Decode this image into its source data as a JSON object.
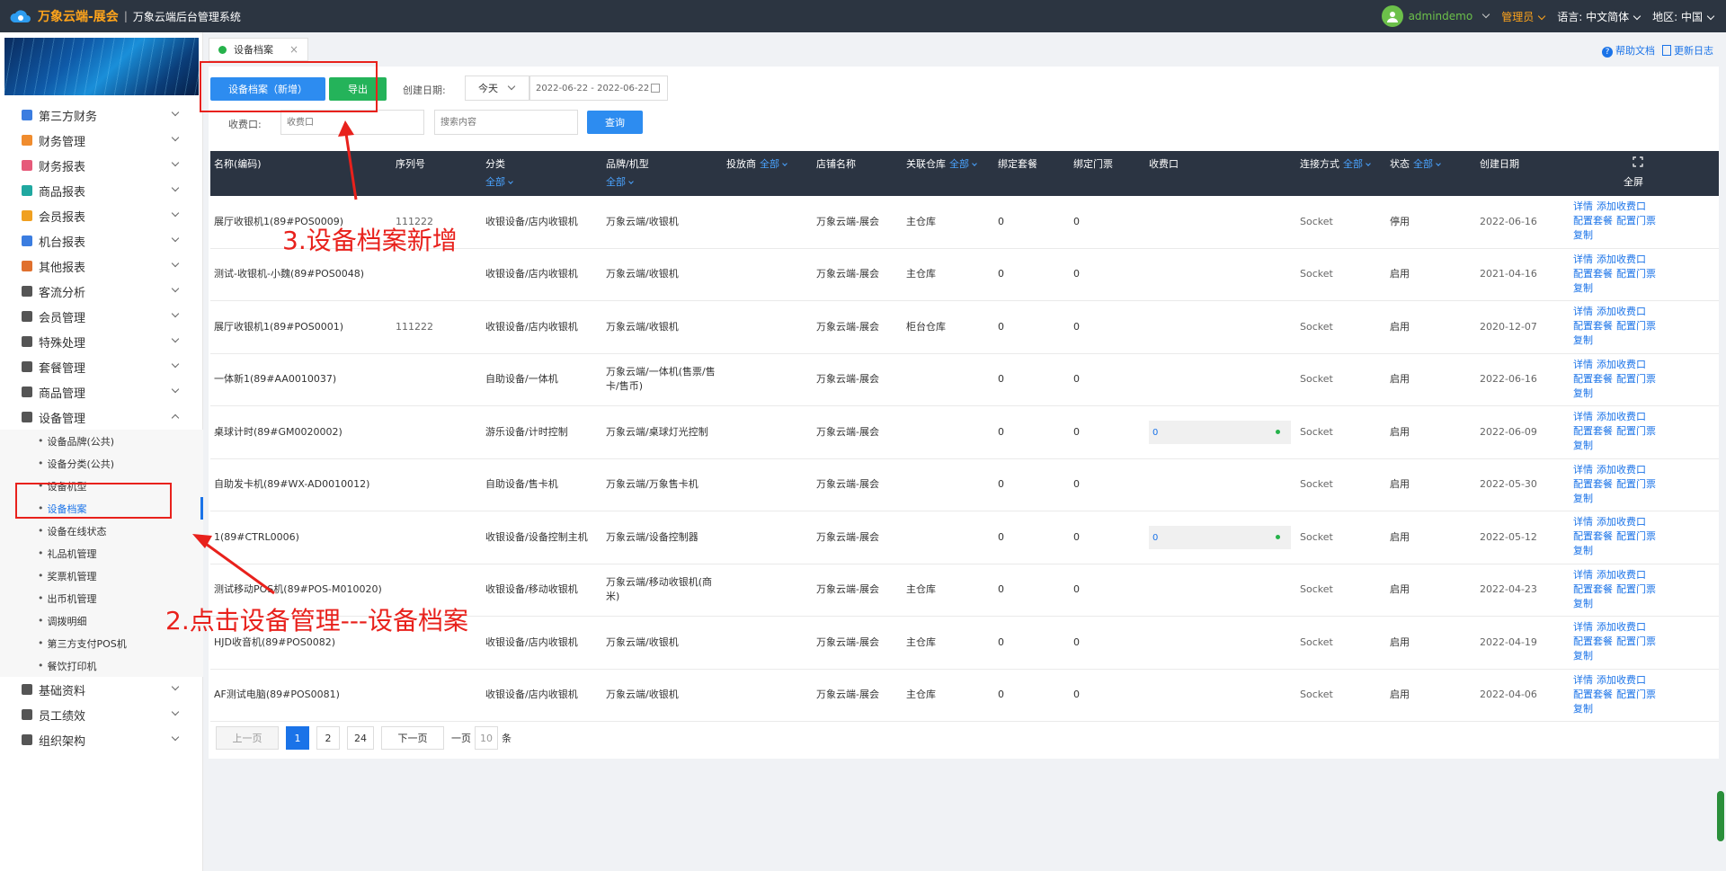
{
  "topbar": {
    "app_name": "万象云端-展会",
    "separator": "|",
    "system_name": "万象云端后台管理系统",
    "user": "admindemo",
    "role": "管理员",
    "lang_label": "语言:",
    "lang_value": "中文简体",
    "region_label": "地区:",
    "region_value": "中国"
  },
  "sidebar": {
    "menu_top": [
      {
        "label": "第三方财务",
        "color": "#3b7de0"
      },
      {
        "label": "财务管理",
        "color": "#f08c2e"
      },
      {
        "label": "财务报表",
        "color": "#e65a7a"
      },
      {
        "label": "商品报表",
        "color": "#20a8a0"
      },
      {
        "label": "会员报表",
        "color": "#f0a020"
      },
      {
        "label": "机台报表",
        "color": "#3b7de0"
      },
      {
        "label": "其他报表",
        "color": "#e0702e"
      },
      {
        "label": "客流分析",
        "color": "#555555"
      },
      {
        "label": "会员管理",
        "color": "#555555"
      },
      {
        "label": "特殊处理",
        "color": "#555555"
      },
      {
        "label": "套餐管理",
        "color": "#555555"
      },
      {
        "label": "商品管理",
        "color": "#555555"
      },
      {
        "label": "设备管理",
        "color": "#555555"
      }
    ],
    "submenu": [
      "设备品牌(公共)",
      "设备分类(公共)",
      "设备机型",
      "设备档案",
      "设备在线状态",
      "礼品机管理",
      "奖票机管理",
      "出币机管理",
      "调拨明细",
      "第三方支付POS机",
      "餐饮打印机"
    ],
    "menu_bottom": [
      {
        "label": "基础资料",
        "color": "#555555"
      },
      {
        "label": "员工绩效",
        "color": "#555555"
      },
      {
        "label": "组织架构",
        "color": "#555555"
      }
    ]
  },
  "tabs": {
    "active": "设备档案",
    "close": "×"
  },
  "top_links": {
    "help": "帮助文档",
    "changelog": "更新日志"
  },
  "toolbar": {
    "add_button": "设备档案（新增）",
    "export_button": "导出",
    "date_label": "创建日期:",
    "date_preset": "今天",
    "date_range": "2022-06-22 - 2022-06-22",
    "counter_label": "收费口:",
    "counter_placeholder": "收费口",
    "search_placeholder": "搜索内容",
    "query_button": "查询"
  },
  "table": {
    "headers": {
      "name": "名称(编码)",
      "serial": "序列号",
      "category": "分类",
      "brand": "品牌/机型",
      "placer": "投放商",
      "store": "店铺名称",
      "warehouse": "关联仓库",
      "package": "绑定套餐",
      "ticket": "绑定门票",
      "counter": "收费口",
      "connect": "连接方式",
      "status": "状态",
      "created": "创建日期",
      "fullscreen": "全屏"
    },
    "filter_all": "全部",
    "ops": {
      "detail": "详情",
      "add_counter": "添加收费口",
      "config_package": "配置套餐",
      "config_ticket": "配置门票",
      "copy": "复制"
    },
    "rows": [
      {
        "name": "展厅收银机1(89#POS0009)",
        "serial": "111222",
        "category": "收银设备/店内收银机",
        "brand": "万象云端/收银机",
        "store": "万象云端-展会",
        "warehouse": "主仓库",
        "package": "0",
        "ticket": "0",
        "counter": "",
        "connect": "Socket",
        "status": "停用",
        "created": "2022-06-16"
      },
      {
        "name": "测试-收银机-小魏(89#POS0048)",
        "serial": "",
        "category": "收银设备/店内收银机",
        "brand": "万象云端/收银机",
        "store": "万象云端-展会",
        "warehouse": "主仓库",
        "package": "0",
        "ticket": "0",
        "counter": "",
        "connect": "Socket",
        "status": "启用",
        "created": "2021-04-16"
      },
      {
        "name": "展厅收银机1(89#POS0001)",
        "serial": "111222",
        "category": "收银设备/店内收银机",
        "brand": "万象云端/收银机",
        "store": "万象云端-展会",
        "warehouse": "柜台仓库",
        "package": "0",
        "ticket": "0",
        "counter": "",
        "connect": "Socket",
        "status": "启用",
        "created": "2020-12-07"
      },
      {
        "name": "一体新1(89#AA0010037)",
        "serial": "",
        "category": "自助设备/一体机",
        "brand": "万象云端/一体机(售票/售卡/售币)",
        "store": "万象云端-展会",
        "warehouse": "",
        "package": "0",
        "ticket": "0",
        "counter": "",
        "connect": "Socket",
        "status": "启用",
        "created": "2022-06-16"
      },
      {
        "name": "桌球计时(89#GM0020002)",
        "serial": "",
        "category": "游乐设备/计时控制",
        "brand": "万象云端/桌球灯光控制",
        "store": "万象云端-展会",
        "warehouse": "",
        "package": "0",
        "ticket": "0",
        "counter": "0",
        "connect": "Socket",
        "status": "启用",
        "created": "2022-06-09"
      },
      {
        "name": "自助发卡机(89#WX-AD0010012)",
        "serial": "",
        "category": "自助设备/售卡机",
        "brand": "万象云端/万象售卡机",
        "store": "万象云端-展会",
        "warehouse": "",
        "package": "0",
        "ticket": "0",
        "counter": "",
        "connect": "Socket",
        "status": "启用",
        "created": "2022-05-30"
      },
      {
        "name": "1(89#CTRL0006)",
        "serial": "",
        "category": "收银设备/设备控制主机",
        "brand": "万象云端/设备控制器",
        "store": "万象云端-展会",
        "warehouse": "",
        "package": "0",
        "ticket": "0",
        "counter": "0",
        "connect": "Socket",
        "status": "启用",
        "created": "2022-05-12"
      },
      {
        "name": "测试移动POS机(89#POS-M010020)",
        "serial": "",
        "category": "收银设备/移动收银机",
        "brand": "万象云端/移动收银机(商米)",
        "store": "万象云端-展会",
        "warehouse": "主仓库",
        "package": "0",
        "ticket": "0",
        "counter": "",
        "connect": "Socket",
        "status": "启用",
        "created": "2022-04-23"
      },
      {
        "name": "HJD收音机(89#POS0082)",
        "serial": "",
        "category": "收银设备/店内收银机",
        "brand": "万象云端/收银机",
        "store": "万象云端-展会",
        "warehouse": "主仓库",
        "package": "0",
        "ticket": "0",
        "counter": "",
        "connect": "Socket",
        "status": "启用",
        "created": "2022-04-19"
      },
      {
        "name": "AF测试电脑(89#POS0081)",
        "serial": "",
        "category": "收银设备/店内收银机",
        "brand": "万象云端/收银机",
        "store": "万象云端-展会",
        "warehouse": "主仓库",
        "package": "0",
        "ticket": "0",
        "counter": "",
        "connect": "Socket",
        "status": "启用",
        "created": "2022-04-06"
      }
    ]
  },
  "pagination": {
    "prev": "上一页",
    "pages": [
      "1",
      "2",
      "24"
    ],
    "next": "下一页",
    "per_page_label": "一页",
    "per_page": "10",
    "unit": "条"
  },
  "annotations": {
    "step3": "3.设备档案新增",
    "step2": "2.点击设备管理---设备档案"
  },
  "colors": {
    "topbar": "#2c3541",
    "accent": "#1a73e8",
    "green": "#24b35a",
    "annotation": "#e8211c",
    "orange": "#ffa41b"
  }
}
